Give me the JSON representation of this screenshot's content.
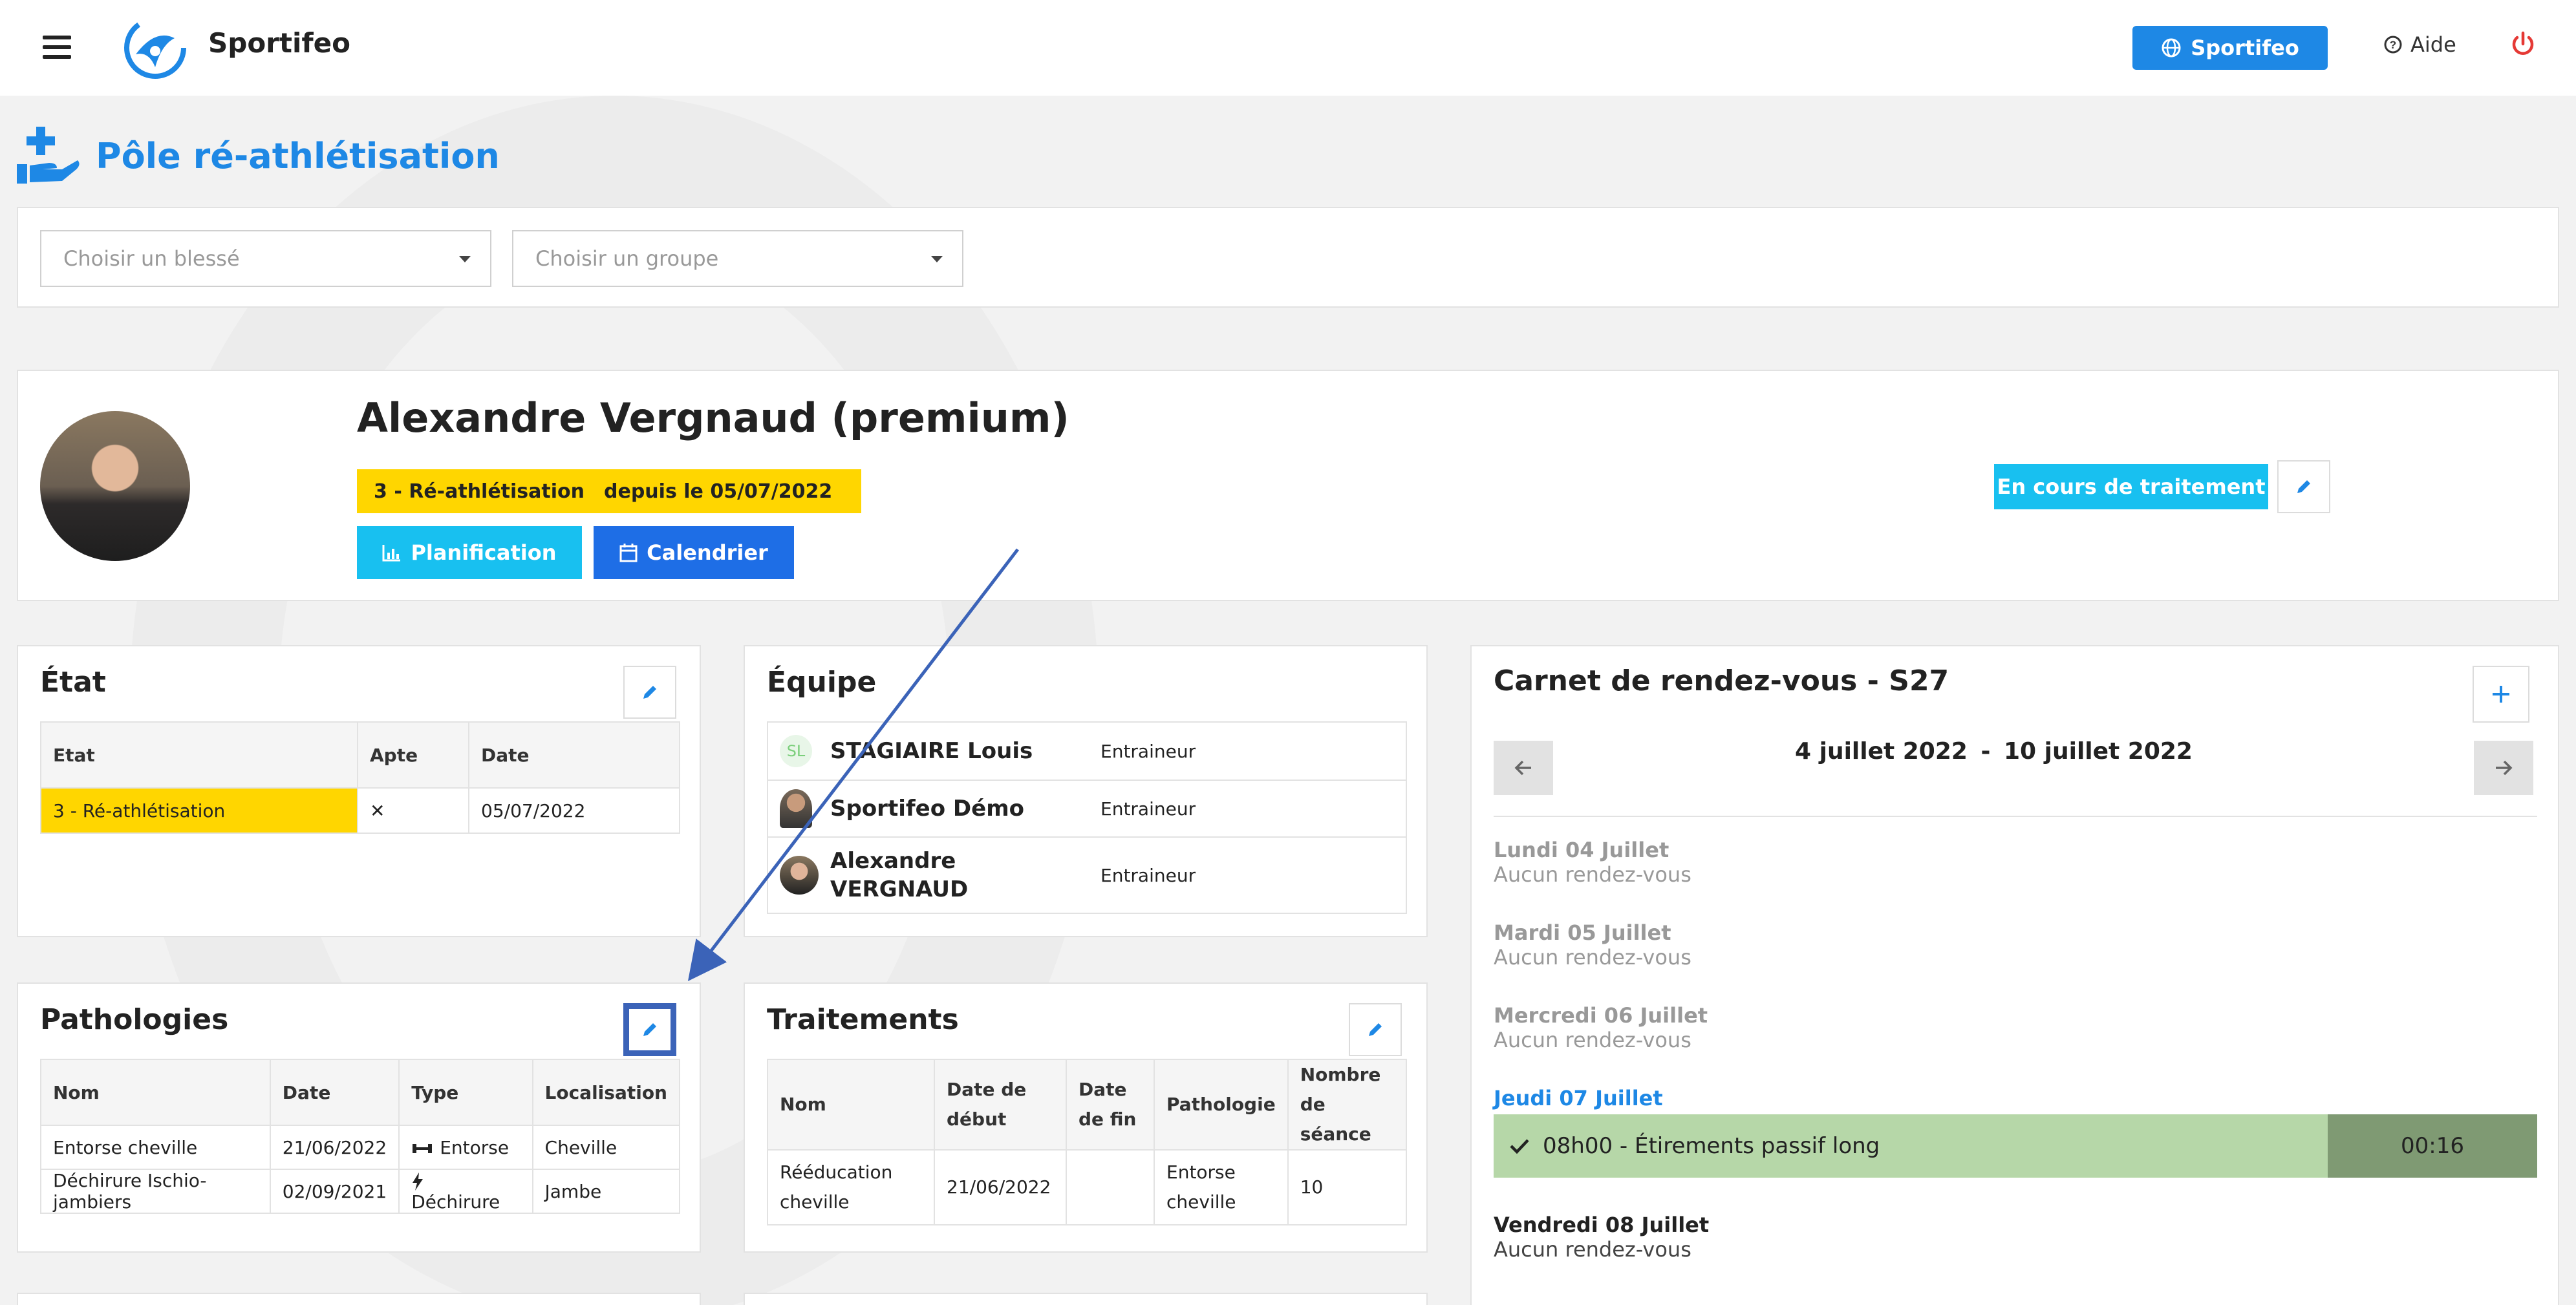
{
  "header": {
    "brand": "Sportifeo",
    "sportifeo_button": "Sportifeo",
    "help_label": "Aide"
  },
  "page": {
    "title": "Pôle ré-athlétisation"
  },
  "filters": {
    "injured_placeholder": "Choisir un blessé",
    "group_placeholder": "Choisir un groupe"
  },
  "profile": {
    "name": "Alexandre Vergnaud (premium)",
    "phase": "3 - Ré-athlétisation",
    "since": "depuis le 05/07/2022",
    "planning_button": "Planification",
    "calendar_button": "Calendrier",
    "status": "En cours de traitement"
  },
  "etat": {
    "title": "État",
    "columns": [
      "Etat",
      "Apte",
      "Date"
    ],
    "rows": [
      {
        "etat": "3 - Ré-athlétisation",
        "apte": "✕",
        "date": "05/07/2022"
      }
    ],
    "highlight_color": "#ffd600"
  },
  "equipe": {
    "title": "Équipe",
    "members": [
      {
        "initials": "SL",
        "name": "STAGIAIRE Louis",
        "role": "Entraineur"
      },
      {
        "name": "Sportifeo Démo",
        "role": "Entraineur"
      },
      {
        "name": "Alexandre VERGNAUD",
        "role": "Entraineur"
      }
    ]
  },
  "pathologies": {
    "title": "Pathologies",
    "columns": [
      "Nom",
      "Date",
      "Type",
      "Localisation"
    ],
    "rows": [
      {
        "nom": "Entorse cheville",
        "date": "21/06/2022",
        "type": "Entorse",
        "type_icon": "bone-icon",
        "localisation": "Cheville"
      },
      {
        "nom": "Déchirure Ischio-jambiers",
        "date": "02/09/2021",
        "type": "Déchirure",
        "type_icon": "bolt-icon",
        "localisation": "Jambe"
      }
    ]
  },
  "traitements": {
    "title": "Traitements",
    "columns": [
      "Nom",
      "Date de début",
      "Date de fin",
      "Pathologie",
      "Nombre de séance"
    ],
    "rows": [
      {
        "nom": "Rééducation cheville",
        "debut": "21/06/2022",
        "fin": "",
        "pathologie": "Entorse cheville",
        "seances": "10"
      }
    ]
  },
  "carnet": {
    "title": "Carnet de rendez-vous - S27",
    "week_start": "4 juillet 2022",
    "week_sep": "-",
    "week_end": "10 juillet 2022",
    "days": [
      {
        "name": "Lundi 04 Juillet",
        "text": "Aucun rendez-vous"
      },
      {
        "name": "Mardi 05 Juillet",
        "text": "Aucun rendez-vous"
      },
      {
        "name": "Mercredi 06 Juillet",
        "text": "Aucun rendez-vous"
      },
      {
        "name": "Jeudi 07 Juillet",
        "text": ""
      },
      {
        "name": "Vendredi 08 Juillet",
        "text": "Aucun rendez-vous"
      }
    ],
    "appointment": {
      "label": "08h00 - Étirements passif long",
      "duration": "00:16",
      "color": "#b6d7a8"
    }
  }
}
